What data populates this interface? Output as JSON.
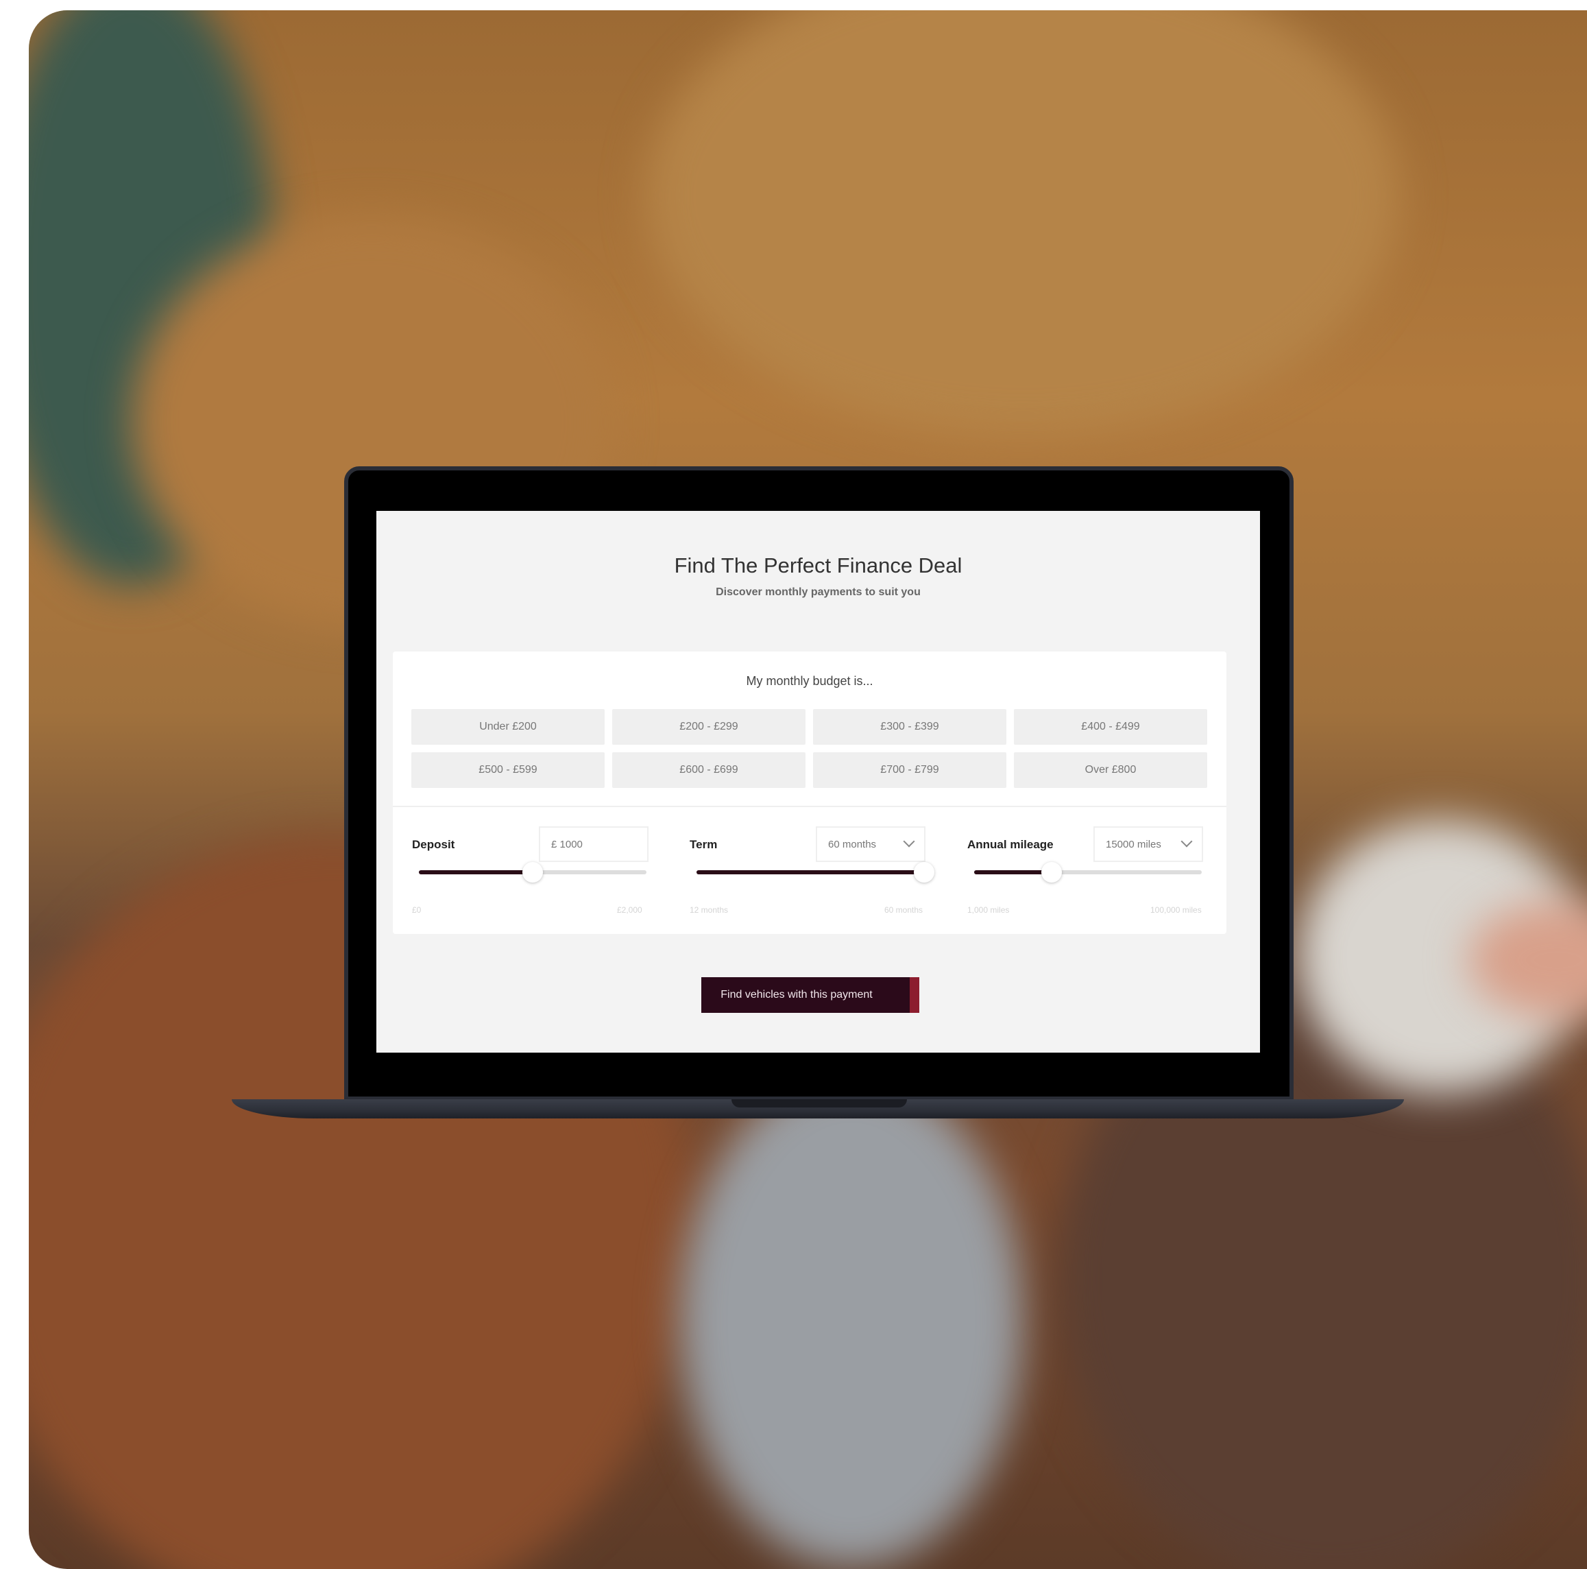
{
  "colors": {
    "accent": "#2b0a1a",
    "accent_edge": "#8c1d2e",
    "screen_bg": "#f3f3f3"
  },
  "page": {
    "title": "Find The Perfect Finance Deal",
    "subtitle": "Discover monthly payments to suit you"
  },
  "budget": {
    "label": "My monthly budget is...",
    "options": [
      "Under £200",
      "£200 - £299",
      "£300 - £399",
      "£400 - £499",
      "£500 - £599",
      "£600 - £699",
      "£700 - £799",
      "Over £800"
    ]
  },
  "deposit": {
    "label": "Deposit",
    "value": "£ 1000",
    "fraction": 0.5,
    "min_label": "£0",
    "max_label": "£2,000"
  },
  "term": {
    "label": "Term",
    "value": "60 months",
    "fraction": 1.0,
    "min_label": "12 months",
    "max_label": "60 months"
  },
  "mileage": {
    "label": "Annual mileage",
    "value": "15000 miles",
    "fraction": 0.34,
    "min_label": "1,000 miles",
    "max_label": "100,000 miles"
  },
  "cta": {
    "label": "Find vehicles with this payment"
  }
}
